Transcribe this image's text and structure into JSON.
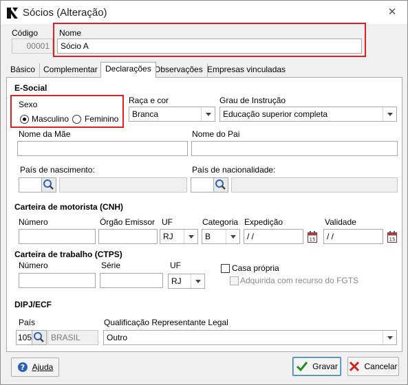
{
  "window": {
    "title": "Sócios (Alteração)",
    "close_glyph": "✕"
  },
  "header": {
    "codigo_label": "Código",
    "codigo_value": "00001",
    "nome_label": "Nome",
    "nome_value": "Sócio A"
  },
  "tabs": [
    {
      "label": "Básico",
      "active": false
    },
    {
      "label": "Complementar",
      "active": false
    },
    {
      "label": "Declarações",
      "active": true
    },
    {
      "label": "Observações",
      "active": false
    },
    {
      "label": "Empresas vinculadas",
      "active": false
    }
  ],
  "esocial": {
    "section_title": "E-Social",
    "sexo_label": "Sexo",
    "sexo_options": [
      "Masculino",
      "Feminino"
    ],
    "sexo_selected": "Masculino",
    "raca_label": "Raça e cor",
    "raca_value": "Branca",
    "grau_label": "Grau de Instrução",
    "grau_value": "Educação superior completa",
    "nome_mae_label": "Nome da Mãe",
    "nome_mae_value": "",
    "nome_pai_label": "Nome do Pai",
    "nome_pai_value": "",
    "pais_nasc_label": "País de nascimento:",
    "pais_nasc_value": "",
    "pais_nac_label": "País de nacionalidade:",
    "pais_nac_value": ""
  },
  "cnh": {
    "section_title": "Carteira de motorista (CNH)",
    "numero_label": "Número",
    "orgao_label": "Órgão Emissor",
    "uf_label": "UF",
    "uf_value": "RJ",
    "categoria_label": "Categoria",
    "categoria_value": "B",
    "expedicao_label": "Expedição",
    "expedicao_value": " /  /",
    "validade_label": "Validade",
    "validade_value": " /  /"
  },
  "ctps": {
    "section_title": "Carteira de trabalho (CTPS)",
    "numero_label": "Número",
    "serie_label": "Série",
    "uf_label": "UF",
    "uf_value": "RJ",
    "casa_propria_label": "Casa própria",
    "fgts_label": "Adquirida com recurso do FGTS"
  },
  "dipj": {
    "section_title": "DIPJ/ECF",
    "pais_label": "País",
    "pais_code": "105",
    "pais_name": "BRASIL",
    "qualif_label": "Qualificação Representante Legal",
    "qualif_value": "Outro"
  },
  "footer": {
    "help_label": "Ajuda",
    "save_label": "Gravar",
    "cancel_label": "Cancelar"
  },
  "colors": {
    "highlight": "#e02020",
    "save_check": "#1e8c1e",
    "cancel_x": "#d02020",
    "help_icon": "#2a62b8"
  }
}
